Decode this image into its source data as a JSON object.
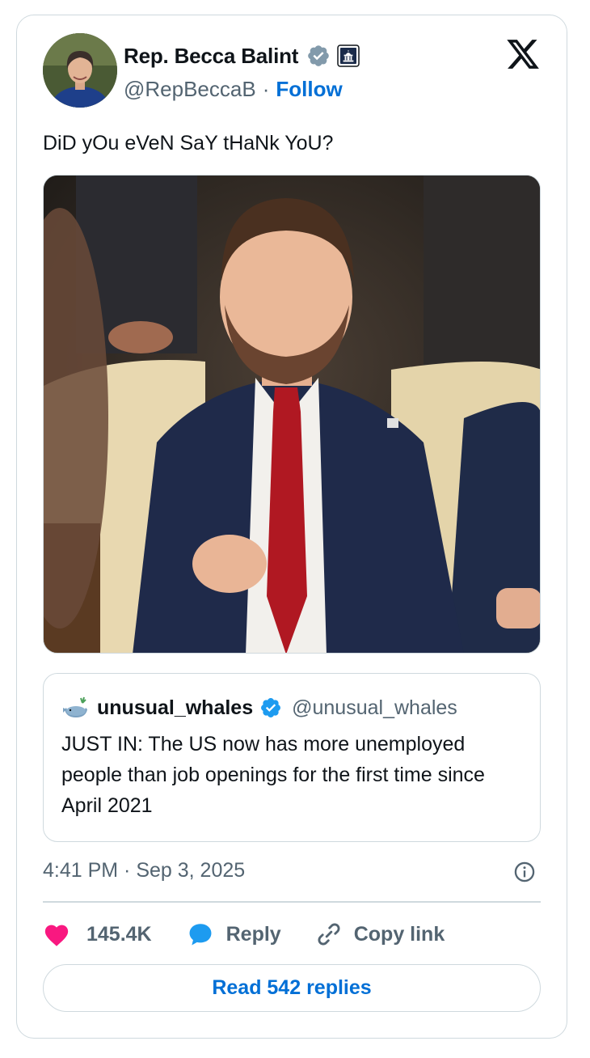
{
  "author": {
    "name": "Rep. Becca Balint",
    "handle": "@RepBeccaB",
    "separator": "·",
    "follow_label": "Follow"
  },
  "tweet": {
    "text": "DiD yOu eVeN SaY tHaNk YoU?"
  },
  "quote": {
    "name": "unusual_whales",
    "handle": "@unusual_whales",
    "text": "JUST IN: The US now has more unemployed people than job openings for the first time since April 2021"
  },
  "meta": {
    "timestamp": "4:41 PM · Sep 3, 2025"
  },
  "actions": {
    "likes": "145.4K",
    "reply_label": "Reply",
    "copy_label": "Copy link",
    "read_replies": "Read 542 replies"
  },
  "colors": {
    "accent": "#006fd6",
    "verified": "#1d9bf0",
    "gray_verified": "#829aab",
    "like": "#f91880",
    "secondary_text": "#536471",
    "border": "#cfd9de"
  },
  "icons": [
    "gray-verified-badge-icon",
    "capitol-affiliation-icon",
    "x-logo-icon",
    "verified-badge-icon",
    "whale-icon",
    "info-icon",
    "heart-icon",
    "reply-bubble-icon",
    "link-icon"
  ]
}
